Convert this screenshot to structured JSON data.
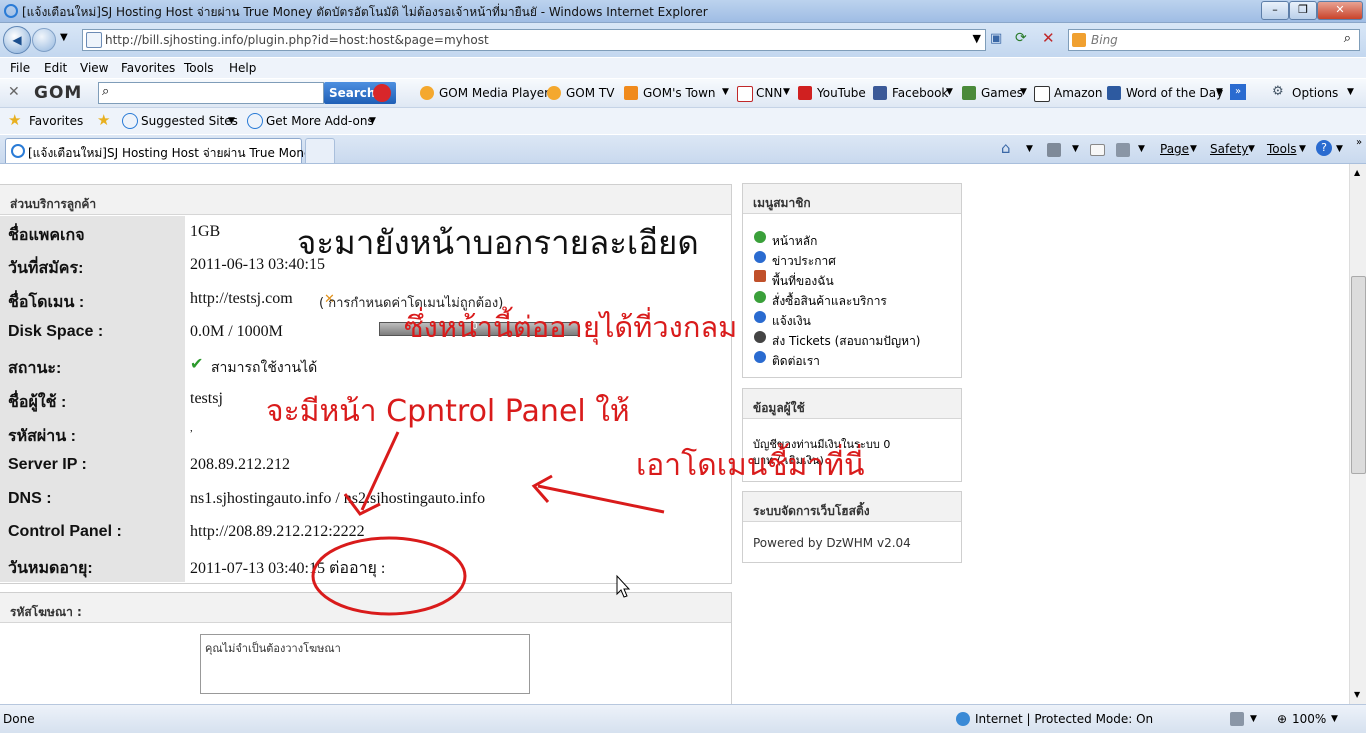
{
  "window": {
    "title": "[แจ้งเตือนใหม่]SJ Hosting Host จ่ายผ่าน True Money ตัดบัตรอัตโนมัติ ไม่ต้องรอเจ้าหน้าที่มายืนยั - Windows Internet Explorer"
  },
  "nav": {
    "url": "http://bill.sjhosting.info/plugin.php?id=host:host&page=myhost",
    "search_placeholder": "Bing"
  },
  "menu": [
    "File",
    "Edit",
    "View",
    "Favorites",
    "Tools",
    "Help"
  ],
  "toolbar": {
    "brand": "GOM",
    "search_button": "Search",
    "links": [
      "GOM Media Player",
      "GOM TV",
      "GOM's Town",
      "CNN",
      "YouTube",
      "Facebook",
      "Games",
      "Amazon",
      "Word of the Day"
    ],
    "options": "Options"
  },
  "favorites_bar": {
    "favorites": "Favorites",
    "suggested": "Suggested Sites",
    "addons": "Get More Add-ons"
  },
  "tab": {
    "title": "[แจ้งเตือนใหม่]SJ Hosting Host จ่ายผ่าน True Mone..."
  },
  "commands": {
    "page": "Page",
    "safety": "Safety",
    "tools": "Tools"
  },
  "customer": {
    "section_title": "ส่วนบริการลูกค้า",
    "rows": [
      {
        "label": "ชื่อแพคเกจ",
        "value": "1GB"
      },
      {
        "label": "วันที่สมัคร:",
        "value": "2011-06-13 03:40:15"
      },
      {
        "label": "ชื่อโดเมน :",
        "value": "http://testsj.com"
      },
      {
        "label": "Disk Space :",
        "value": " 0.0M / 1000M"
      },
      {
        "label": "สถานะ:",
        "value": "สามารถใช้งานได้"
      },
      {
        "label": "ชื่อผู้ใช้ :",
        "value": "testsj"
      },
      {
        "label": "รหัสผ่าน :",
        "value": ","
      },
      {
        "label": "Server IP :",
        "value": "208.89.212.212"
      },
      {
        "label": "DNS :",
        "value": "ns1.sjhostingauto.info / ns2.sjhostingauto.info"
      },
      {
        "label": "Control Panel :",
        "value": "http://208.89.212.212:2222"
      },
      {
        "label": "วันหมดอายุ:",
        "value": "2011-07-13 03:40:15 ต่ออายุ :"
      }
    ],
    "domain_warning": "( การกำหนดค่าโดเมนไม่ถูกต้อง)",
    "disk_usage": 0.0,
    "disk_percent": "0"
  },
  "ads": {
    "title": "รหัสโฆษณา :",
    "text": "คุณไม่จำเป็นต้องวางโฆษณา"
  },
  "member_menu": {
    "title": "เมนูสมาชิก",
    "items": [
      "หน้าหลัก",
      "ข่าวประกาศ",
      "พื้นที่ของฉัน",
      "สั่งซื้อสินค้าและบริการ",
      "แจ้งเงิน",
      "ส่ง Tickets (สอบถามปัญหา)",
      "ติดต่อเรา"
    ]
  },
  "user_info": {
    "title": "ข้อมูลผู้ใช้",
    "line1": "บัญชีของท่านมีเงินในระบบ 0",
    "line2": "บาท ( เติมเงิน)"
  },
  "hosting_system": {
    "title": "ระบบจัดการเว็บโฮสติ้ง",
    "powered": "Powered by DzWHM v2.04"
  },
  "annotations": {
    "heading": "จะมายังหน้าบอกรายละเอียด",
    "renew": "ซึ่งหน้านี้ต่ออายุได้ที่วงกลม",
    "control_panel": "จะมีหน้า   Cpntrol Panel ให้",
    "domain": "เอาโดเมนชี้มาที่นี่"
  },
  "status": {
    "left": "Done",
    "zone": "Internet | Protected Mode: On",
    "zoom": "100%"
  },
  "colors": {
    "annotation_red": "#d91b1b",
    "label_bg": "#e4e4e4",
    "link_blue": "#2a6bd0"
  }
}
